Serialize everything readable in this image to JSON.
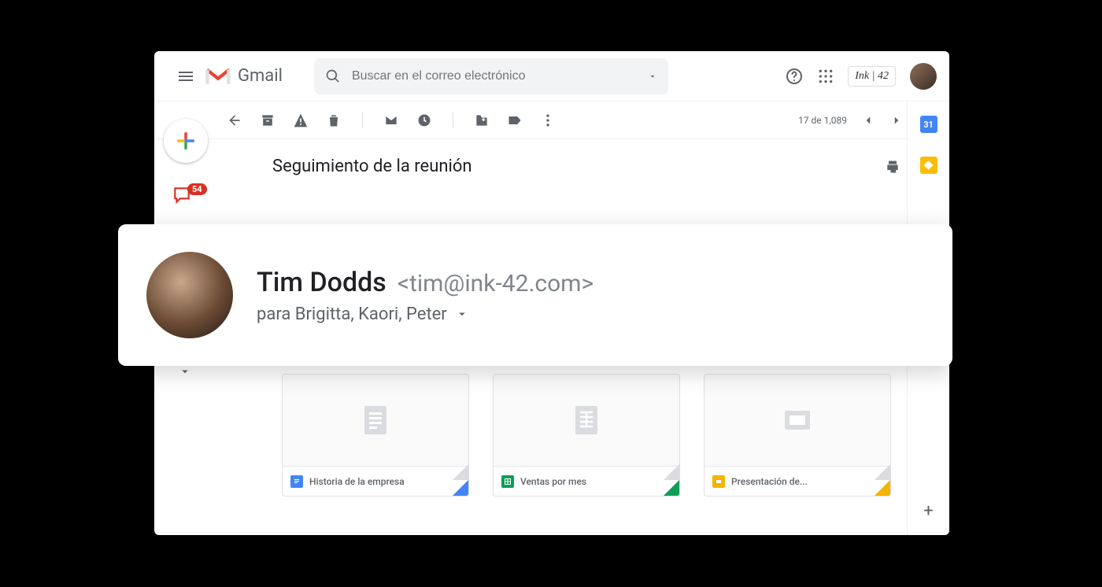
{
  "header": {
    "product": "Gmail",
    "search_placeholder": "Buscar en el correo electrónico",
    "brand_badge": "Ink | 42"
  },
  "toolbar": {
    "count": "17 de 1,089"
  },
  "sidebar": {
    "chat_badge": "54"
  },
  "rail": {
    "calendar_day": "31"
  },
  "subject": "Seguimiento de la reunión",
  "sender": {
    "name": "Tim Dodds",
    "email": "<tim@ink-42.com>",
    "to_line": "para Brigitta, Kaori, Peter"
  },
  "attachments": [
    {
      "title": "Historia de la empresa",
      "type": "docs"
    },
    {
      "title": "Ventas por mes",
      "type": "sheets"
    },
    {
      "title": "Presentación de...",
      "type": "slides"
    }
  ]
}
